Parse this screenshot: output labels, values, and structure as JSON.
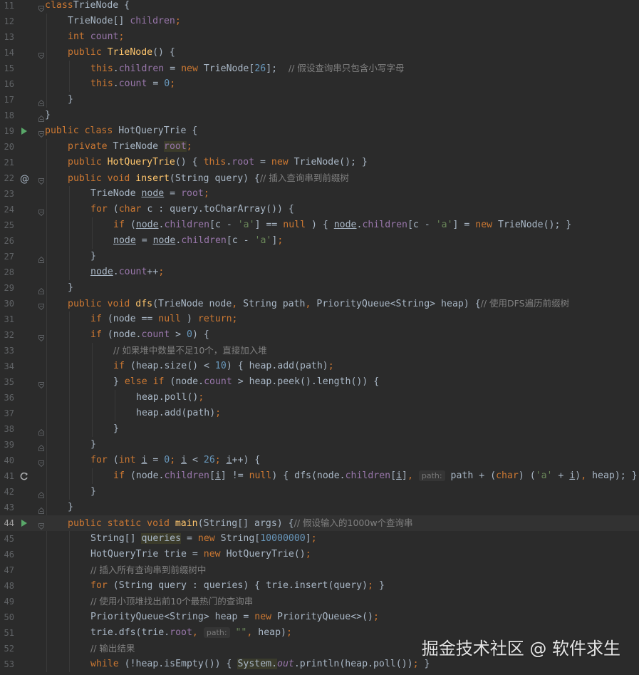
{
  "editor": {
    "lines": [
      {
        "n": "11",
        "fold": "open",
        "segs": [
          [
            "kw",
            "class"
          ],
          [
            "",
            "TrieNode {"
          ]
        ]
      },
      {
        "n": "12",
        "indent": 1,
        "segs": [
          [
            "",
            "TrieNode[] "
          ],
          [
            "field",
            "children"
          ],
          [
            "kw",
            ";"
          ]
        ]
      },
      {
        "n": "13",
        "indent": 1,
        "segs": [
          [
            "kw",
            "int "
          ],
          [
            "field",
            "count"
          ],
          [
            "kw",
            ";"
          ]
        ]
      },
      {
        "n": "14",
        "indent": 1,
        "fold": "open",
        "segs": [
          [
            "kw",
            "public "
          ],
          [
            "fn",
            "TrieNode"
          ],
          [
            "",
            "() {"
          ]
        ]
      },
      {
        "n": "15",
        "indent": 2,
        "segs": [
          [
            "kw",
            "this"
          ],
          [
            "",
            "."
          ],
          [
            "field",
            "children"
          ],
          [
            "",
            " = "
          ],
          [
            "kw",
            "new "
          ],
          [
            "",
            "TrieNode["
          ],
          [
            "num",
            "26"
          ],
          [
            "",
            "];  "
          ],
          [
            "cm",
            "// 假设查询串只包含小写字母"
          ]
        ]
      },
      {
        "n": "16",
        "indent": 2,
        "segs": [
          [
            "kw",
            "this"
          ],
          [
            "",
            "."
          ],
          [
            "field",
            "count"
          ],
          [
            "",
            " = "
          ],
          [
            "num",
            "0"
          ],
          [
            "kw",
            ";"
          ]
        ]
      },
      {
        "n": "17",
        "indent": 1,
        "fold": "close",
        "segs": [
          [
            "",
            "}"
          ]
        ]
      },
      {
        "n": "18",
        "fold": "close",
        "segs": [
          [
            "",
            "}"
          ]
        ]
      },
      {
        "n": "19",
        "gutter": "run",
        "fold": "open",
        "segs": [
          [
            "kw",
            "public class "
          ],
          [
            "",
            "HotQueryTrie {"
          ]
        ]
      },
      {
        "n": "20",
        "indent": 1,
        "segs": [
          [
            "kw",
            "private "
          ],
          [
            "",
            "TrieNode "
          ],
          [
            "field hl",
            "root"
          ],
          [
            "kw",
            ";"
          ]
        ]
      },
      {
        "n": "21",
        "indent": 1,
        "segs": [
          [
            "kw",
            "public "
          ],
          [
            "fn",
            "HotQueryTrie"
          ],
          [
            "",
            "() { "
          ],
          [
            "kw",
            "this"
          ],
          [
            "",
            "."
          ],
          [
            "field",
            "root"
          ],
          [
            "",
            " = "
          ],
          [
            "kw",
            "new "
          ],
          [
            "",
            "TrieNode(); }"
          ]
        ]
      },
      {
        "n": "22",
        "gutter": "at",
        "fold": "open",
        "indent": 1,
        "segs": [
          [
            "kw",
            "public void "
          ],
          [
            "fn",
            "insert"
          ],
          [
            "",
            "(String query) {"
          ],
          [
            "cm",
            "// 插入查询串到前缀树"
          ]
        ]
      },
      {
        "n": "23",
        "indent": 2,
        "segs": [
          [
            "",
            "TrieNode "
          ],
          [
            "ul",
            "node"
          ],
          [
            "",
            " = "
          ],
          [
            "field",
            "root"
          ],
          [
            "kw",
            ";"
          ]
        ]
      },
      {
        "n": "24",
        "indent": 2,
        "fold": "open",
        "segs": [
          [
            "kw",
            "for "
          ],
          [
            "",
            "("
          ],
          [
            "kw",
            "char "
          ],
          [
            "",
            "c : query.toCharArray()) {"
          ]
        ]
      },
      {
        "n": "25",
        "indent": 3,
        "segs": [
          [
            "kw",
            "if "
          ],
          [
            "",
            "("
          ],
          [
            "ul",
            "node"
          ],
          [
            "",
            "."
          ],
          [
            "field",
            "children"
          ],
          [
            "",
            "[c - "
          ],
          [
            "str",
            "'a'"
          ],
          [
            "",
            "] == "
          ],
          [
            "kw",
            "null"
          ],
          [
            "",
            " ) { "
          ],
          [
            "ul",
            "node"
          ],
          [
            "",
            "."
          ],
          [
            "field",
            "children"
          ],
          [
            "",
            "[c - "
          ],
          [
            "str",
            "'a'"
          ],
          [
            "",
            "] = "
          ],
          [
            "kw",
            "new "
          ],
          [
            "",
            "TrieNode(); }"
          ]
        ]
      },
      {
        "n": "26",
        "indent": 3,
        "segs": [
          [
            "ul",
            "node"
          ],
          [
            "",
            " = "
          ],
          [
            "ul",
            "node"
          ],
          [
            "",
            "."
          ],
          [
            "field",
            "children"
          ],
          [
            "",
            "[c - "
          ],
          [
            "str",
            "'a'"
          ],
          [
            "",
            "]"
          ],
          [
            "kw",
            ";"
          ]
        ]
      },
      {
        "n": "27",
        "indent": 2,
        "fold": "close",
        "segs": [
          [
            "",
            "}"
          ]
        ]
      },
      {
        "n": "28",
        "indent": 2,
        "segs": [
          [
            "ul",
            "node"
          ],
          [
            "",
            "."
          ],
          [
            "field",
            "count"
          ],
          [
            "",
            "++"
          ],
          [
            "kw",
            ";"
          ]
        ]
      },
      {
        "n": "29",
        "indent": 1,
        "fold": "close",
        "segs": [
          [
            "",
            "}"
          ]
        ]
      },
      {
        "n": "30",
        "indent": 1,
        "fold": "open",
        "segs": [
          [
            "kw",
            "public void "
          ],
          [
            "fn",
            "dfs"
          ],
          [
            "",
            "(TrieNode node"
          ],
          [
            "kw",
            ", "
          ],
          [
            "",
            "String path"
          ],
          [
            "kw",
            ", "
          ],
          [
            "",
            "PriorityQueue<String> heap) {"
          ],
          [
            "cm",
            "// 使用DFS遍历前缀树"
          ]
        ]
      },
      {
        "n": "31",
        "indent": 2,
        "segs": [
          [
            "kw",
            "if "
          ],
          [
            "",
            "(node == "
          ],
          [
            "kw",
            "null"
          ],
          [
            "",
            " ) "
          ],
          [
            "kw",
            "return;"
          ]
        ]
      },
      {
        "n": "32",
        "indent": 2,
        "fold": "open",
        "segs": [
          [
            "kw",
            "if "
          ],
          [
            "",
            "(node."
          ],
          [
            "field",
            "count"
          ],
          [
            "",
            " > "
          ],
          [
            "num",
            "0"
          ],
          [
            "",
            ") {"
          ]
        ]
      },
      {
        "n": "33",
        "indent": 3,
        "segs": [
          [
            "cm",
            "// 如果堆中数量不足10个，直接加入堆"
          ]
        ]
      },
      {
        "n": "34",
        "indent": 3,
        "segs": [
          [
            "kw",
            "if "
          ],
          [
            "",
            "(heap.size() < "
          ],
          [
            "num",
            "10"
          ],
          [
            "",
            ") { heap.add(path)"
          ],
          [
            "kw",
            ";"
          ]
        ]
      },
      {
        "n": "35",
        "indent": 3,
        "fold": "open",
        "segs": [
          [
            "",
            "} "
          ],
          [
            "kw",
            "else if "
          ],
          [
            "",
            "(node."
          ],
          [
            "field",
            "count"
          ],
          [
            "",
            " > heap.peek().length()) {"
          ]
        ]
      },
      {
        "n": "36",
        "indent": 4,
        "segs": [
          [
            "",
            "heap.poll()"
          ],
          [
            "kw",
            ";"
          ]
        ]
      },
      {
        "n": "37",
        "indent": 4,
        "segs": [
          [
            "",
            "heap.add(path)"
          ],
          [
            "kw",
            ";"
          ]
        ]
      },
      {
        "n": "38",
        "indent": 3,
        "fold": "close",
        "segs": [
          [
            "",
            "}"
          ]
        ]
      },
      {
        "n": "39",
        "indent": 2,
        "fold": "close",
        "segs": [
          [
            "",
            "}"
          ]
        ]
      },
      {
        "n": "40",
        "indent": 2,
        "fold": "open",
        "segs": [
          [
            "kw",
            "for "
          ],
          [
            "",
            "("
          ],
          [
            "kw",
            "int "
          ],
          [
            "ul",
            "i"
          ],
          [
            "",
            " = "
          ],
          [
            "num",
            "0"
          ],
          [
            "kw",
            "; "
          ],
          [
            "ul",
            "i"
          ],
          [
            "",
            " < "
          ],
          [
            "num",
            "26"
          ],
          [
            "kw",
            "; "
          ],
          [
            "ul",
            "i"
          ],
          [
            "",
            "++) {"
          ]
        ]
      },
      {
        "n": "41",
        "gutter": "recurse",
        "indent": 3,
        "segs": [
          [
            "kw",
            "if "
          ],
          [
            "",
            "(node."
          ],
          [
            "field",
            "children"
          ],
          [
            "",
            "["
          ],
          [
            "ul",
            "i"
          ],
          [
            "",
            "] != "
          ],
          [
            "kw",
            "null"
          ],
          [
            "",
            ") { dfs(node."
          ],
          [
            "field",
            "children"
          ],
          [
            "",
            "["
          ],
          [
            "ul",
            "i"
          ],
          [
            "",
            "]"
          ],
          [
            "kw",
            ", "
          ],
          [
            "hint",
            "path:"
          ],
          [
            "",
            " path + ("
          ],
          [
            "kw",
            "char"
          ],
          [
            "",
            ") ("
          ],
          [
            "str",
            "'a'"
          ],
          [
            "",
            " + "
          ],
          [
            "ul",
            "i"
          ],
          [
            "",
            ")"
          ],
          [
            "kw",
            ", "
          ],
          [
            "",
            "heap); }"
          ]
        ]
      },
      {
        "n": "42",
        "indent": 2,
        "fold": "close",
        "segs": [
          [
            "",
            "}"
          ]
        ]
      },
      {
        "n": "43",
        "indent": 1,
        "fold": "close",
        "segs": [
          [
            "",
            "}"
          ]
        ]
      },
      {
        "n": "44",
        "gutter": "run",
        "current": true,
        "fold": "open",
        "indent": 1,
        "segs": [
          [
            "kw",
            "public static void "
          ],
          [
            "fn",
            "main"
          ],
          [
            "",
            "(String[] args) {"
          ],
          [
            "cm",
            "// 假设输入的1000w个查询串"
          ]
        ]
      },
      {
        "n": "45",
        "indent": 2,
        "segs": [
          [
            "",
            "String[] "
          ],
          [
            "hl",
            "queries"
          ],
          [
            "",
            " = "
          ],
          [
            "kw",
            "new "
          ],
          [
            "",
            "String["
          ],
          [
            "num",
            "10000000"
          ],
          [
            "",
            "]"
          ],
          [
            "kw",
            ";"
          ]
        ]
      },
      {
        "n": "46",
        "indent": 2,
        "segs": [
          [
            "",
            "HotQueryTrie trie = "
          ],
          [
            "kw",
            "new "
          ],
          [
            "",
            "HotQueryTrie()"
          ],
          [
            "kw",
            ";"
          ]
        ]
      },
      {
        "n": "47",
        "indent": 2,
        "segs": [
          [
            "cm",
            "// 插入所有查询串到前缀树中"
          ]
        ]
      },
      {
        "n": "48",
        "indent": 2,
        "segs": [
          [
            "kw",
            "for "
          ],
          [
            "",
            "(String query : queries) { trie.insert(query)"
          ],
          [
            "kw",
            "; "
          ],
          [
            "",
            "}"
          ]
        ]
      },
      {
        "n": "49",
        "indent": 2,
        "segs": [
          [
            "cm",
            "// 使用小顶堆找出前10个最热门的查询串"
          ]
        ]
      },
      {
        "n": "50",
        "indent": 2,
        "segs": [
          [
            "",
            "PriorityQueue<String> heap = "
          ],
          [
            "kw",
            "new "
          ],
          [
            "",
            "PriorityQueue<>()"
          ],
          [
            "kw",
            ";"
          ]
        ]
      },
      {
        "n": "51",
        "indent": 2,
        "segs": [
          [
            "",
            "trie.dfs(trie."
          ],
          [
            "field",
            "root"
          ],
          [
            "kw",
            ", "
          ],
          [
            "hint",
            "path:"
          ],
          [
            "",
            " "
          ],
          [
            "str",
            "\"\""
          ],
          [
            "kw",
            ", "
          ],
          [
            "",
            "heap)"
          ],
          [
            "kw",
            ";"
          ]
        ]
      },
      {
        "n": "52",
        "indent": 2,
        "segs": [
          [
            "cm",
            "// 输出结果"
          ]
        ]
      },
      {
        "n": "53",
        "indent": 2,
        "segs": [
          [
            "kw",
            "while "
          ],
          [
            "",
            "(!heap.isEmpty()) { "
          ],
          [
            "sys",
            "System."
          ],
          [
            "field st",
            "out"
          ],
          [
            "",
            ".println(heap.poll())"
          ],
          [
            "kw",
            "; "
          ],
          [
            "",
            "}"
          ]
        ]
      }
    ]
  },
  "watermark": "掘金技术社区 @ 软件求生",
  "colors": {
    "background": "#2b2b2b",
    "keyword": "#cc7832",
    "method": "#ffc66d",
    "field": "#9876aa",
    "number": "#6897bb",
    "string": "#6a8759",
    "comment": "#808080",
    "run_icon": "#59a869"
  }
}
